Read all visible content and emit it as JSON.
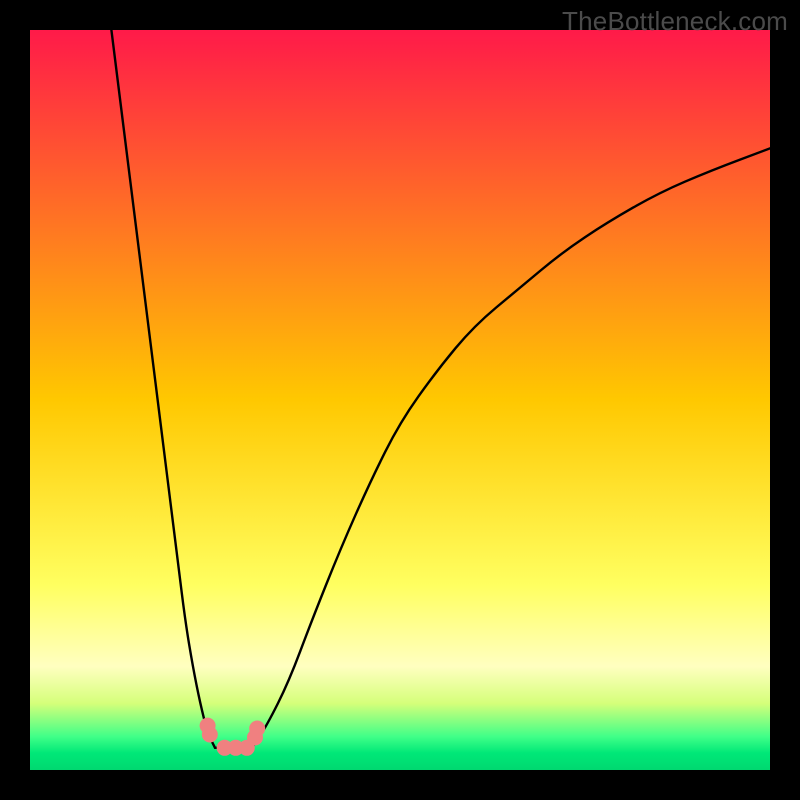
{
  "watermark": "TheBottleneck.com",
  "chart_data": {
    "type": "line",
    "title": "",
    "xlabel": "",
    "ylabel": "",
    "xlim": [
      0,
      100
    ],
    "ylim": [
      0,
      100
    ],
    "grid": false,
    "background_gradient": {
      "stops": [
        {
          "offset": 0.0,
          "color": "#ff1a49"
        },
        {
          "offset": 0.5,
          "color": "#ffc800"
        },
        {
          "offset": 0.75,
          "color": "#ffff60"
        },
        {
          "offset": 0.86,
          "color": "#ffffc0"
        },
        {
          "offset": 0.91,
          "color": "#d5ff7a"
        },
        {
          "offset": 0.955,
          "color": "#40ff88"
        },
        {
          "offset": 0.977,
          "color": "#00e878"
        },
        {
          "offset": 1.0,
          "color": "#00d870"
        }
      ]
    },
    "series": [
      {
        "name": "left-branch",
        "stroke": "#000000",
        "x": [
          11,
          12,
          13,
          14,
          15,
          16,
          17,
          18,
          19,
          20,
          21,
          22,
          23,
          24,
          25
        ],
        "values": [
          100,
          92,
          84,
          76,
          68,
          60,
          52,
          44,
          36,
          28,
          20,
          14,
          9,
          5,
          3
        ]
      },
      {
        "name": "right-branch",
        "stroke": "#000000",
        "x": [
          30,
          32,
          35,
          38,
          42,
          46,
          50,
          55,
          60,
          66,
          72,
          78,
          85,
          92,
          100
        ],
        "values": [
          3,
          6,
          12,
          20,
          30,
          39,
          47,
          54,
          60,
          65,
          70,
          74,
          78,
          81,
          84
        ]
      }
    ],
    "flat_region": {
      "x": [
        25,
        30
      ],
      "values": [
        3,
        3
      ]
    },
    "markers": {
      "name": "highlight-dots",
      "color": "#f08080",
      "points": [
        {
          "x": 24.0,
          "y": 6.0
        },
        {
          "x": 24.3,
          "y": 4.8
        },
        {
          "x": 26.3,
          "y": 3.0
        },
        {
          "x": 27.8,
          "y": 3.0
        },
        {
          "x": 29.3,
          "y": 3.0
        },
        {
          "x": 30.4,
          "y": 4.4
        },
        {
          "x": 30.7,
          "y": 5.6
        }
      ],
      "radius_px": 8
    }
  }
}
